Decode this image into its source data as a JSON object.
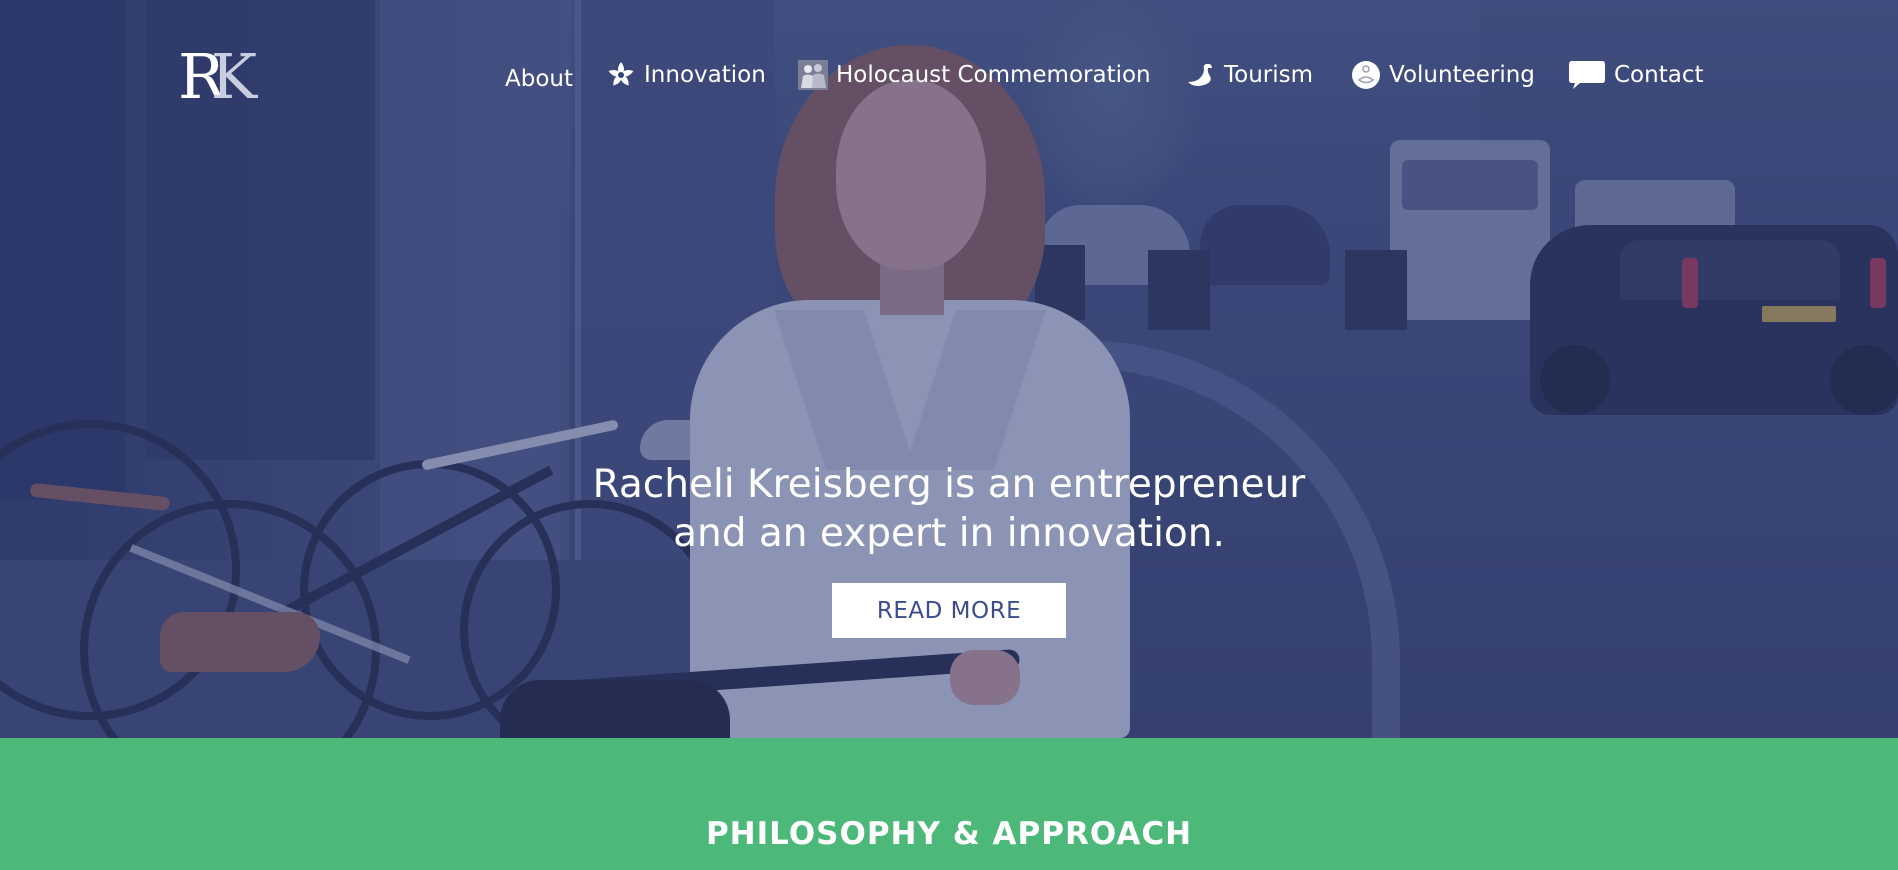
{
  "logo": {
    "letter_r": "R",
    "letter_k": "K"
  },
  "nav": {
    "items": [
      {
        "label": "About",
        "icon": ""
      },
      {
        "label": "Innovation",
        "icon": "flower-icon"
      },
      {
        "label": "Holocaust Commemoration",
        "icon": "people-icon"
      },
      {
        "label": "Tourism",
        "icon": "swan-icon"
      },
      {
        "label": "Volunteering",
        "icon": "hands-icon"
      },
      {
        "label": "Contact",
        "icon": "speech-bubble-icon"
      }
    ]
  },
  "hero": {
    "headline_line1": "Racheli Kreisberg is an entrepreneur",
    "headline_line2": "and an expert in innovation.",
    "cta_label": "READ MORE"
  },
  "philosophy": {
    "title": "PHILOSOPHY & APPROACH"
  },
  "colors": {
    "overlay": "#36427a",
    "accent_green": "#4cb87a",
    "button_text": "#3c4d8f",
    "nav_text": "#ffffff"
  }
}
